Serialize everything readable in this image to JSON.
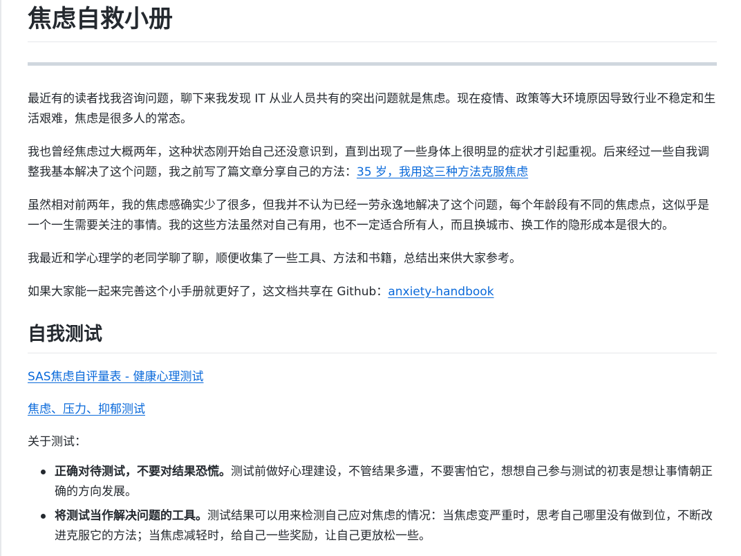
{
  "title": "焦虑自救小册",
  "intro": {
    "p1": "最近有的读者找我咨询问题，聊下来我发现 IT 从业人员共有的突出问题就是焦虑。现在疫情、政策等大环境原因导致行业不稳定和生活艰难，焦虑是很多人的常态。",
    "p2_text": "我也曾经焦虑过大概两年，这种状态刚开始自己还没意识到，直到出现了一些身体上很明显的症状才引起重视。后来经过一些自我调整我基本解决了这个问题，我之前写了篇文章分享自己的方法：",
    "p2_link": "35 岁，我用这三种方法克服焦虑",
    "p3": "虽然相对前两年，我的焦虑感确实少了很多，但我并不认为已经一劳永逸地解决了这个问题，每个年龄段有不同的焦虑点，这似乎是一个一生需要关注的事情。我的这些方法虽然对自己有用，也不一定适合所有人，而且换城市、换工作的隐形成本是很大的。",
    "p4": "我最近和学心理学的老同学聊了聊，顺便收集了一些工具、方法和书籍，总结出来供大家参考。",
    "p5_text": "如果大家能一起来完善这个小手册就更好了，这文档共享在 Github：",
    "p5_link": "anxiety-handbook"
  },
  "section_self_test": {
    "heading": "自我测试",
    "link1": "SAS焦虑自评量表 - 健康心理测试",
    "link2": "焦虑、压力、抑郁测试",
    "about_label": "关于测试：",
    "items": [
      {
        "bold": "正确对待测试，不要对结果恐慌。",
        "text": "测试前做好心理建设，不管结果多遭，不要害怕它，想想自己参与测试的初衷是想让事情朝正确的方向发展。"
      },
      {
        "bold": "将测试当作解决问题的工具。",
        "text": "测试结果可以用来检测自己应对焦虑的情况：当焦虑变严重时，思考自己哪里没有做到位，不断改进克服它的方法；当焦虑减轻时，给自己一些奖励，让自己更放松一些。"
      }
    ]
  }
}
